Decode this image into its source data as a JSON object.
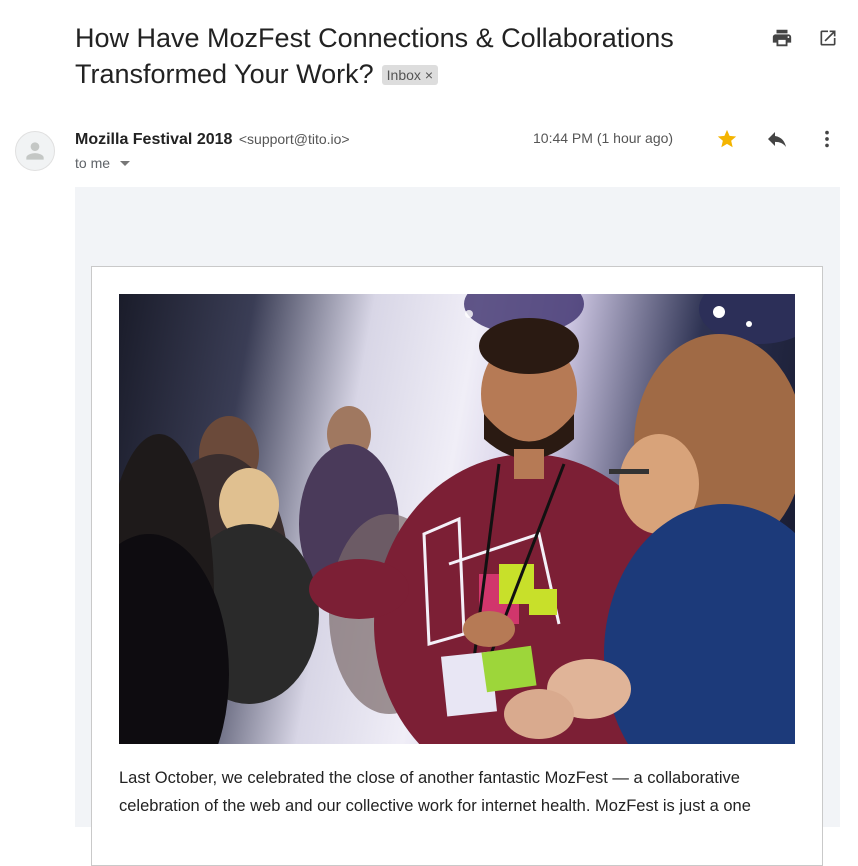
{
  "subject": {
    "title": "How Have MozFest Connections & Collaborations Transformed Your Work?",
    "label": "Inbox",
    "label_remove": "×"
  },
  "toolbar": {
    "print_icon": "print-icon",
    "open_new_window_icon": "open-in-new-icon"
  },
  "sender": {
    "name": "Mozilla Festival 2018",
    "email": "<support@tito.io>",
    "to": "to me",
    "time": "10:44 PM (1 hour ago)",
    "starred": true,
    "star_color": "#f4b400"
  },
  "message": {
    "hero_alt": "Photo of attendees at MozFest",
    "body_line1": "Last October, we celebrated the close of another fantastic MozFest — a collaborative",
    "body_line2": "celebration of the web and our collective work for internet health. MozFest is just a one"
  }
}
